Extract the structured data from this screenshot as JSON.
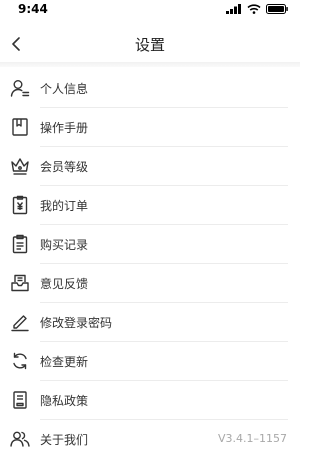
{
  "status_bar": {
    "time": "9:44"
  },
  "header": {
    "title": "设置",
    "back_icon": "chevron-left-icon"
  },
  "menu": {
    "items": [
      {
        "label": "个人信息",
        "icon": "user-profile-icon"
      },
      {
        "label": "操作手册",
        "icon": "bookmark-book-icon"
      },
      {
        "label": "会员等级",
        "icon": "crown-icon"
      },
      {
        "label": "我的订单",
        "icon": "yuan-order-icon"
      },
      {
        "label": "购买记录",
        "icon": "clipboard-icon"
      },
      {
        "label": "意见反馈",
        "icon": "mail-tray-icon"
      },
      {
        "label": "修改登录密码",
        "icon": "pen-icon"
      },
      {
        "label": "检查更新",
        "icon": "refresh-icon"
      },
      {
        "label": "隐私政策",
        "icon": "document-icon"
      },
      {
        "label": "关于我们",
        "icon": "people-icon",
        "value": "V3.4.1–1157"
      }
    ]
  }
}
